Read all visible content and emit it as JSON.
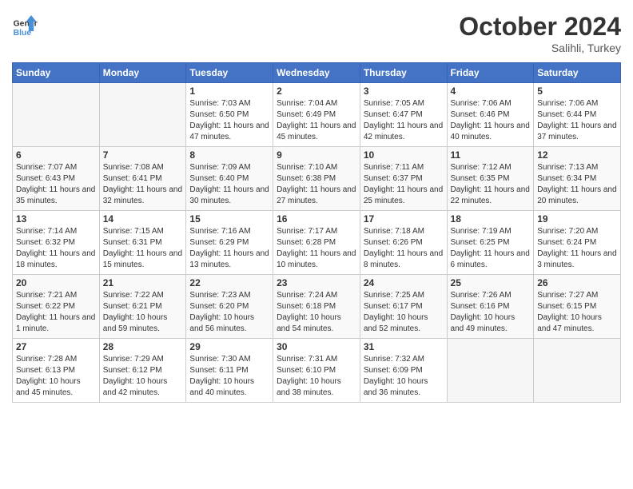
{
  "header": {
    "logo_line1": "General",
    "logo_line2": "Blue",
    "month": "October 2024",
    "location": "Salihli, Turkey"
  },
  "weekdays": [
    "Sunday",
    "Monday",
    "Tuesday",
    "Wednesday",
    "Thursday",
    "Friday",
    "Saturday"
  ],
  "weeks": [
    [
      {
        "day": "",
        "empty": true
      },
      {
        "day": "",
        "empty": true
      },
      {
        "day": "1",
        "sunrise": "7:03 AM",
        "sunset": "6:50 PM",
        "daylight": "11 hours and 47 minutes."
      },
      {
        "day": "2",
        "sunrise": "7:04 AM",
        "sunset": "6:49 PM",
        "daylight": "11 hours and 45 minutes."
      },
      {
        "day": "3",
        "sunrise": "7:05 AM",
        "sunset": "6:47 PM",
        "daylight": "11 hours and 42 minutes."
      },
      {
        "day": "4",
        "sunrise": "7:06 AM",
        "sunset": "6:46 PM",
        "daylight": "11 hours and 40 minutes."
      },
      {
        "day": "5",
        "sunrise": "7:06 AM",
        "sunset": "6:44 PM",
        "daylight": "11 hours and 37 minutes."
      }
    ],
    [
      {
        "day": "6",
        "sunrise": "7:07 AM",
        "sunset": "6:43 PM",
        "daylight": "11 hours and 35 minutes."
      },
      {
        "day": "7",
        "sunrise": "7:08 AM",
        "sunset": "6:41 PM",
        "daylight": "11 hours and 32 minutes."
      },
      {
        "day": "8",
        "sunrise": "7:09 AM",
        "sunset": "6:40 PM",
        "daylight": "11 hours and 30 minutes."
      },
      {
        "day": "9",
        "sunrise": "7:10 AM",
        "sunset": "6:38 PM",
        "daylight": "11 hours and 27 minutes."
      },
      {
        "day": "10",
        "sunrise": "7:11 AM",
        "sunset": "6:37 PM",
        "daylight": "11 hours and 25 minutes."
      },
      {
        "day": "11",
        "sunrise": "7:12 AM",
        "sunset": "6:35 PM",
        "daylight": "11 hours and 22 minutes."
      },
      {
        "day": "12",
        "sunrise": "7:13 AM",
        "sunset": "6:34 PM",
        "daylight": "11 hours and 20 minutes."
      }
    ],
    [
      {
        "day": "13",
        "sunrise": "7:14 AM",
        "sunset": "6:32 PM",
        "daylight": "11 hours and 18 minutes."
      },
      {
        "day": "14",
        "sunrise": "7:15 AM",
        "sunset": "6:31 PM",
        "daylight": "11 hours and 15 minutes."
      },
      {
        "day": "15",
        "sunrise": "7:16 AM",
        "sunset": "6:29 PM",
        "daylight": "11 hours and 13 minutes."
      },
      {
        "day": "16",
        "sunrise": "7:17 AM",
        "sunset": "6:28 PM",
        "daylight": "11 hours and 10 minutes."
      },
      {
        "day": "17",
        "sunrise": "7:18 AM",
        "sunset": "6:26 PM",
        "daylight": "11 hours and 8 minutes."
      },
      {
        "day": "18",
        "sunrise": "7:19 AM",
        "sunset": "6:25 PM",
        "daylight": "11 hours and 6 minutes."
      },
      {
        "day": "19",
        "sunrise": "7:20 AM",
        "sunset": "6:24 PM",
        "daylight": "11 hours and 3 minutes."
      }
    ],
    [
      {
        "day": "20",
        "sunrise": "7:21 AM",
        "sunset": "6:22 PM",
        "daylight": "11 hours and 1 minute."
      },
      {
        "day": "21",
        "sunrise": "7:22 AM",
        "sunset": "6:21 PM",
        "daylight": "10 hours and 59 minutes."
      },
      {
        "day": "22",
        "sunrise": "7:23 AM",
        "sunset": "6:20 PM",
        "daylight": "10 hours and 56 minutes."
      },
      {
        "day": "23",
        "sunrise": "7:24 AM",
        "sunset": "6:18 PM",
        "daylight": "10 hours and 54 minutes."
      },
      {
        "day": "24",
        "sunrise": "7:25 AM",
        "sunset": "6:17 PM",
        "daylight": "10 hours and 52 minutes."
      },
      {
        "day": "25",
        "sunrise": "7:26 AM",
        "sunset": "6:16 PM",
        "daylight": "10 hours and 49 minutes."
      },
      {
        "day": "26",
        "sunrise": "7:27 AM",
        "sunset": "6:15 PM",
        "daylight": "10 hours and 47 minutes."
      }
    ],
    [
      {
        "day": "27",
        "sunrise": "7:28 AM",
        "sunset": "6:13 PM",
        "daylight": "10 hours and 45 minutes."
      },
      {
        "day": "28",
        "sunrise": "7:29 AM",
        "sunset": "6:12 PM",
        "daylight": "10 hours and 42 minutes."
      },
      {
        "day": "29",
        "sunrise": "7:30 AM",
        "sunset": "6:11 PM",
        "daylight": "10 hours and 40 minutes."
      },
      {
        "day": "30",
        "sunrise": "7:31 AM",
        "sunset": "6:10 PM",
        "daylight": "10 hours and 38 minutes."
      },
      {
        "day": "31",
        "sunrise": "7:32 AM",
        "sunset": "6:09 PM",
        "daylight": "10 hours and 36 minutes."
      },
      {
        "day": "",
        "empty": true
      },
      {
        "day": "",
        "empty": true
      }
    ]
  ]
}
